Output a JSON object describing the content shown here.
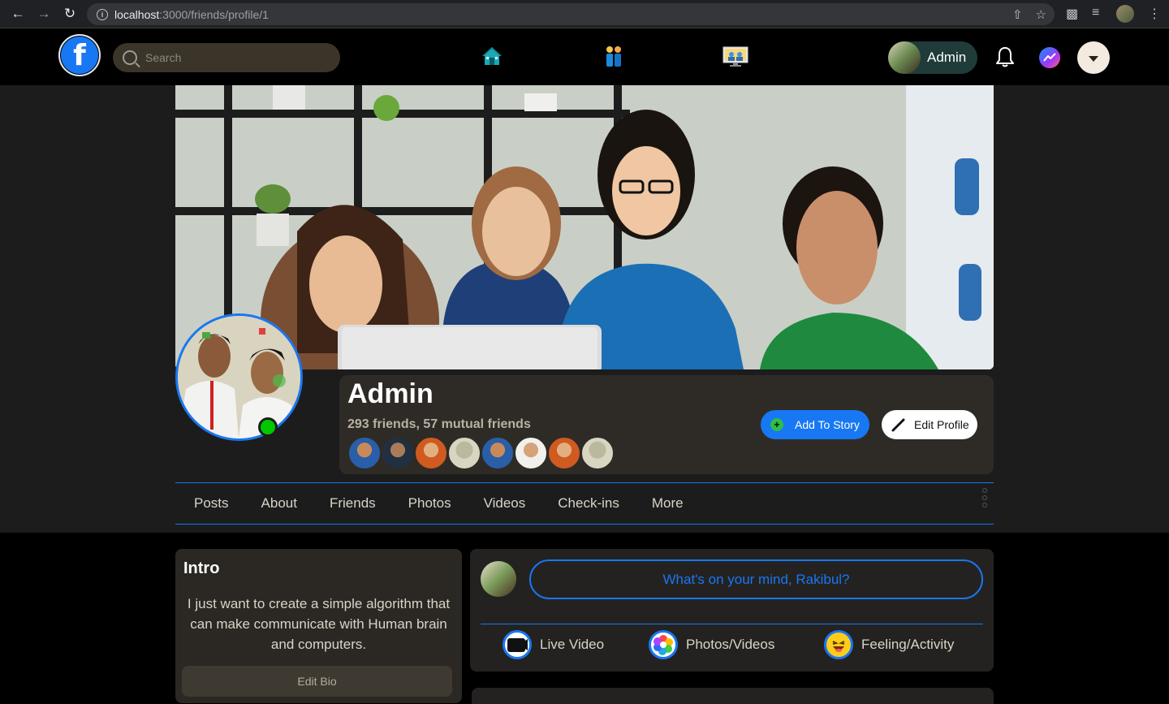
{
  "browser": {
    "url_host": "localhost",
    "url_path": ":3000/friends/profile/1"
  },
  "header": {
    "logo_letter": "f",
    "search_placeholder": "Search",
    "user_name": "Admin",
    "nav_icons": [
      "home-icon",
      "friends-icon",
      "watch-icon"
    ]
  },
  "profile": {
    "name": "Admin",
    "friends_summary": "293 friends, 57 mutual friends",
    "add_story_label": "Add To Story",
    "edit_profile_label": "Edit Profile",
    "online": true
  },
  "tabs": [
    "Posts",
    "About",
    "Friends",
    "Photos",
    "Videos",
    "Check-ins",
    "More"
  ],
  "intro": {
    "title": "Intro",
    "bio": "I just want to create a simple algorithm that can make communicate with Human brain and computers.",
    "edit_bio_label": "Edit Bio"
  },
  "composer": {
    "prompt": "What's on your mind, Rakibul?",
    "actions": [
      {
        "label": "Live Video",
        "icon": "live-video-icon"
      },
      {
        "label": "Photos/Videos",
        "icon": "photos-icon"
      },
      {
        "label": "Feeling/Activity",
        "icon": "feeling-icon"
      }
    ]
  },
  "colors": {
    "accent": "#1877f2",
    "online": "#00c800"
  }
}
